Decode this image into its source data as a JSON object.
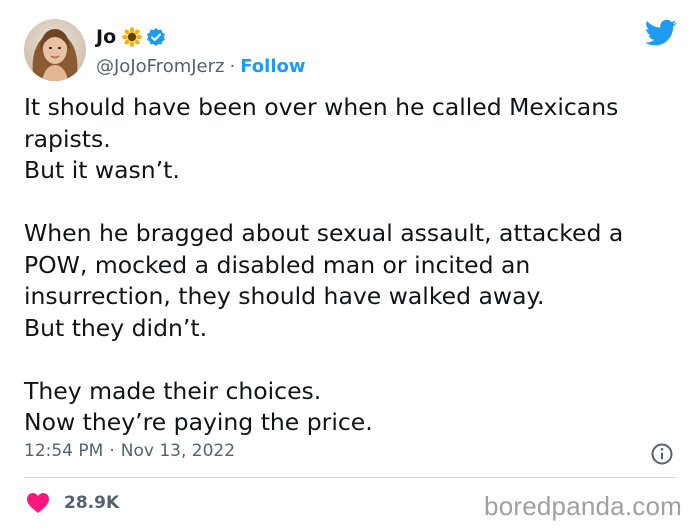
{
  "author": {
    "display_name": "Jo",
    "handle": "@JoJoFromJerz",
    "follow_label": "Follow",
    "separator": "·",
    "emoji_icon": "sunflower-icon",
    "verified_icon": "verified-badge-icon"
  },
  "tweet": {
    "paragraphs": [
      [
        "It should have been over when he called Mexicans",
        "rapists.",
        "But it wasn’t."
      ],
      [
        "When he bragged about sexual assault, attacked a",
        "POW, mocked a disabled man or incited an",
        "insurrection, they should have walked away.",
        "But they didn’t."
      ],
      [
        "They made their choices.",
        "Now they’re paying the price."
      ]
    ],
    "time": "12:54 PM",
    "separator": "·",
    "date": "Nov 13, 2022"
  },
  "engagement": {
    "likes": "28.9K",
    "like_icon": "heart-icon"
  },
  "watermark": "boredpanda.com",
  "colors": {
    "twitter_blue": "#1d9bf0",
    "text": "#0f1419",
    "secondary_text": "#536471",
    "heart": "#f91880",
    "watermark": "#9ea0a3"
  }
}
